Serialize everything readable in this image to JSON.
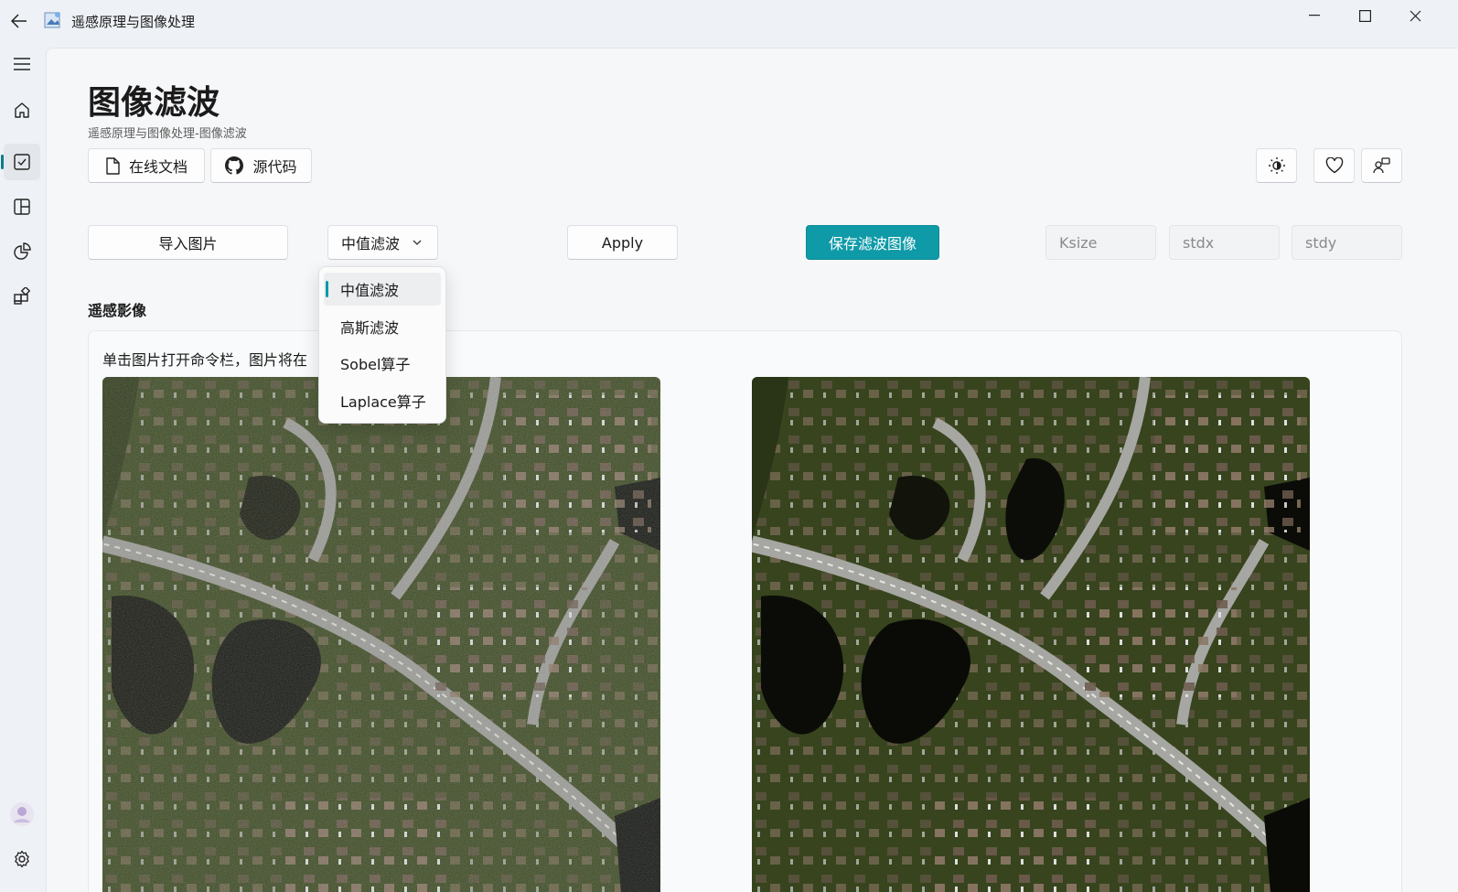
{
  "window": {
    "title": "遥感原理与图像处理",
    "icons": {
      "back": "back-arrow-icon",
      "app": "app-icon",
      "minimize": "minimize-icon",
      "maximize": "maximize-icon",
      "close": "close-icon"
    }
  },
  "nav": {
    "items": [
      {
        "name": "menu",
        "icon": "hamburger-icon"
      },
      {
        "name": "home",
        "icon": "home-icon"
      },
      {
        "name": "tasks",
        "icon": "checkbox-icon",
        "active": true
      },
      {
        "name": "layout",
        "icon": "layout-icon"
      },
      {
        "name": "charts",
        "icon": "pie-chart-icon"
      },
      {
        "name": "extensions",
        "icon": "apps-icon"
      }
    ],
    "bottom": [
      {
        "name": "avatar",
        "icon": "avatar-icon"
      },
      {
        "name": "settings",
        "icon": "gear-icon"
      }
    ]
  },
  "page": {
    "title": "图像滤波",
    "subtitle": "遥感原理与图像处理-图像滤波",
    "links": {
      "docs": "在线文档",
      "source": "源代码"
    },
    "header_actions": [
      "theme-toggle-icon",
      "heart-icon",
      "share-icon"
    ]
  },
  "toolbar": {
    "import_label": "导入图片",
    "filter_selected": "中值滤波",
    "apply_label": "Apply",
    "save_label": "保存滤波图像",
    "ksize_placeholder": "Ksize",
    "stdx_placeholder": "stdx",
    "stdy_placeholder": "stdy"
  },
  "dropdown": {
    "options": [
      "中值滤波",
      "高斯滤波",
      "Sobel算子",
      "Laplace算子"
    ],
    "selected_index": 0
  },
  "section": {
    "label": "遥感影像",
    "hint": "单击图片打开命令栏，图片将在"
  },
  "colors": {
    "accent": "#0f9aa8",
    "background": "#eef1f5"
  }
}
